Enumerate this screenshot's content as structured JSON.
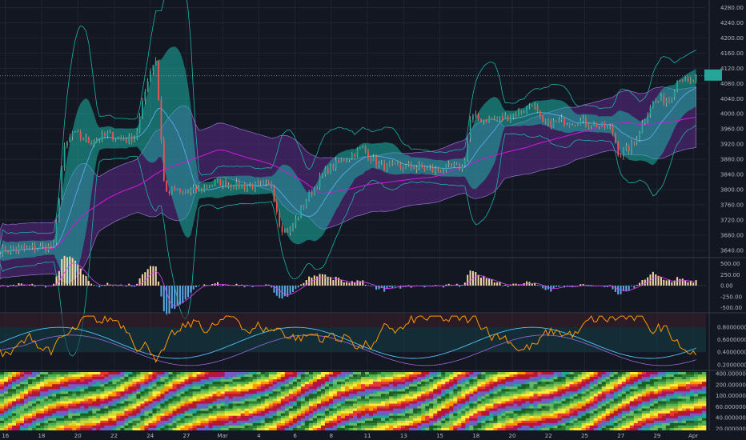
{
  "chart_data": [
    {
      "panel": "price",
      "type": "candlestick",
      "colors": {
        "up": "#26a69a",
        "down": "#ef5350",
        "band_teal": "#1bb3a5",
        "cloud_purple": "#5b2a86",
        "ma_magenta": "#c51bd3",
        "line_blue": "#5aa9e6",
        "wick": "#e0a070"
      },
      "y_ticks": [
        "4280.00",
        "4240.00",
        "4200.00",
        "4160.00",
        "4120.00",
        "4080.00",
        "4040.00",
        "4000.00",
        "3960.00",
        "3920.00",
        "3880.00",
        "3840.00",
        "3800.00",
        "3760.00",
        "3720.00",
        "3680.00",
        "3640.00"
      ],
      "ylim": [
        3625,
        4300
      ],
      "last_price": 4100,
      "anchors": [
        {
          "day": 0,
          "price": 3640
        },
        {
          "day": 3,
          "price": 3650
        },
        {
          "day": 3.5,
          "price": 3900
        },
        {
          "day": 4,
          "price": 3950
        },
        {
          "day": 5,
          "price": 3925
        },
        {
          "day": 6,
          "price": 3945
        },
        {
          "day": 7,
          "price": 3930
        },
        {
          "day": 7.5,
          "price": 3940
        },
        {
          "day": 8.2,
          "price": 4100
        },
        {
          "day": 8.6,
          "price": 4150
        },
        {
          "day": 8.9,
          "price": 3940
        },
        {
          "day": 9.1,
          "price": 3790
        },
        {
          "day": 9.6,
          "price": 3800
        },
        {
          "day": 10,
          "price": 3790
        },
        {
          "day": 11,
          "price": 3800
        },
        {
          "day": 12,
          "price": 3820
        },
        {
          "day": 13,
          "price": 3810
        },
        {
          "day": 14,
          "price": 3810
        },
        {
          "day": 15,
          "price": 3810
        },
        {
          "day": 15.5,
          "price": 3700
        },
        {
          "day": 16,
          "price": 3690
        },
        {
          "day": 17,
          "price": 3780
        },
        {
          "day": 18,
          "price": 3850
        },
        {
          "day": 19,
          "price": 3880
        },
        {
          "day": 20,
          "price": 3910
        },
        {
          "day": 21,
          "price": 3860
        },
        {
          "day": 22,
          "price": 3860
        },
        {
          "day": 23,
          "price": 3860
        },
        {
          "day": 24,
          "price": 3850
        },
        {
          "day": 25,
          "price": 3860
        },
        {
          "day": 25.6,
          "price": 3860
        },
        {
          "day": 26,
          "price": 3990
        },
        {
          "day": 27,
          "price": 3985
        },
        {
          "day": 28,
          "price": 3990
        },
        {
          "day": 29,
          "price": 4010
        },
        {
          "day": 29.4,
          "price": 4030
        },
        {
          "day": 30,
          "price": 3970
        },
        {
          "day": 31,
          "price": 3980
        },
        {
          "day": 32,
          "price": 3980
        },
        {
          "day": 33,
          "price": 3970
        },
        {
          "day": 33.8,
          "price": 3960
        },
        {
          "day": 34.2,
          "price": 3890
        },
        {
          "day": 35,
          "price": 3920
        },
        {
          "day": 36,
          "price": 4030
        },
        {
          "day": 37,
          "price": 4040
        },
        {
          "day": 37.5,
          "price": 4100
        },
        {
          "day": 38,
          "price": 4080
        },
        {
          "day": 38.6,
          "price": 4095
        }
      ]
    },
    {
      "panel": "oscillator-1",
      "type": "histogram",
      "colors": {
        "pos": "#f5d6a8",
        "neg": "#5aa9e6",
        "line": "#e040fb"
      },
      "y_ticks": [
        "500.00",
        "250.00",
        "0.00",
        "-250.00",
        "-500.00"
      ],
      "ylim": [
        -600,
        600
      ]
    },
    {
      "panel": "oscillator-2",
      "type": "line",
      "colors": {
        "orange": "#ff9800",
        "blue": "#4fc3f7",
        "purple": "#9c6ade"
      },
      "y_ticks": [
        "0.8000000",
        "0.6000000",
        "0.4000000",
        "0.2000000"
      ],
      "ylim": [
        0.12,
        1.02
      ]
    },
    {
      "panel": "heatmap",
      "type": "heatmap",
      "y_ticks": [
        "400.000000",
        "200.000000",
        "100.000000",
        "60.000000",
        "40.000000",
        "20.000000"
      ]
    }
  ],
  "x_axis": {
    "ticks": [
      {
        "day": 0.3,
        "label": "16"
      },
      {
        "day": 2.3,
        "label": "18"
      },
      {
        "day": 4.3,
        "label": "20"
      },
      {
        "day": 6.3,
        "label": "22"
      },
      {
        "day": 8.3,
        "label": "24"
      },
      {
        "day": 10.3,
        "label": "27"
      },
      {
        "day": 12.3,
        "label": "Mar"
      },
      {
        "day": 14.3,
        "label": "4"
      },
      {
        "day": 16.3,
        "label": "6"
      },
      {
        "day": 18.3,
        "label": "8"
      },
      {
        "day": 20.3,
        "label": "11"
      },
      {
        "day": 22.3,
        "label": "13"
      },
      {
        "day": 24.3,
        "label": "15"
      },
      {
        "day": 26.3,
        "label": "18"
      },
      {
        "day": 28.3,
        "label": "20"
      },
      {
        "day": 30.3,
        "label": "22"
      },
      {
        "day": 32.3,
        "label": "25"
      },
      {
        "day": 34.3,
        "label": "27"
      },
      {
        "day": 36.3,
        "label": "29"
      },
      {
        "day": 38.3,
        "label": "Apr"
      }
    ]
  }
}
